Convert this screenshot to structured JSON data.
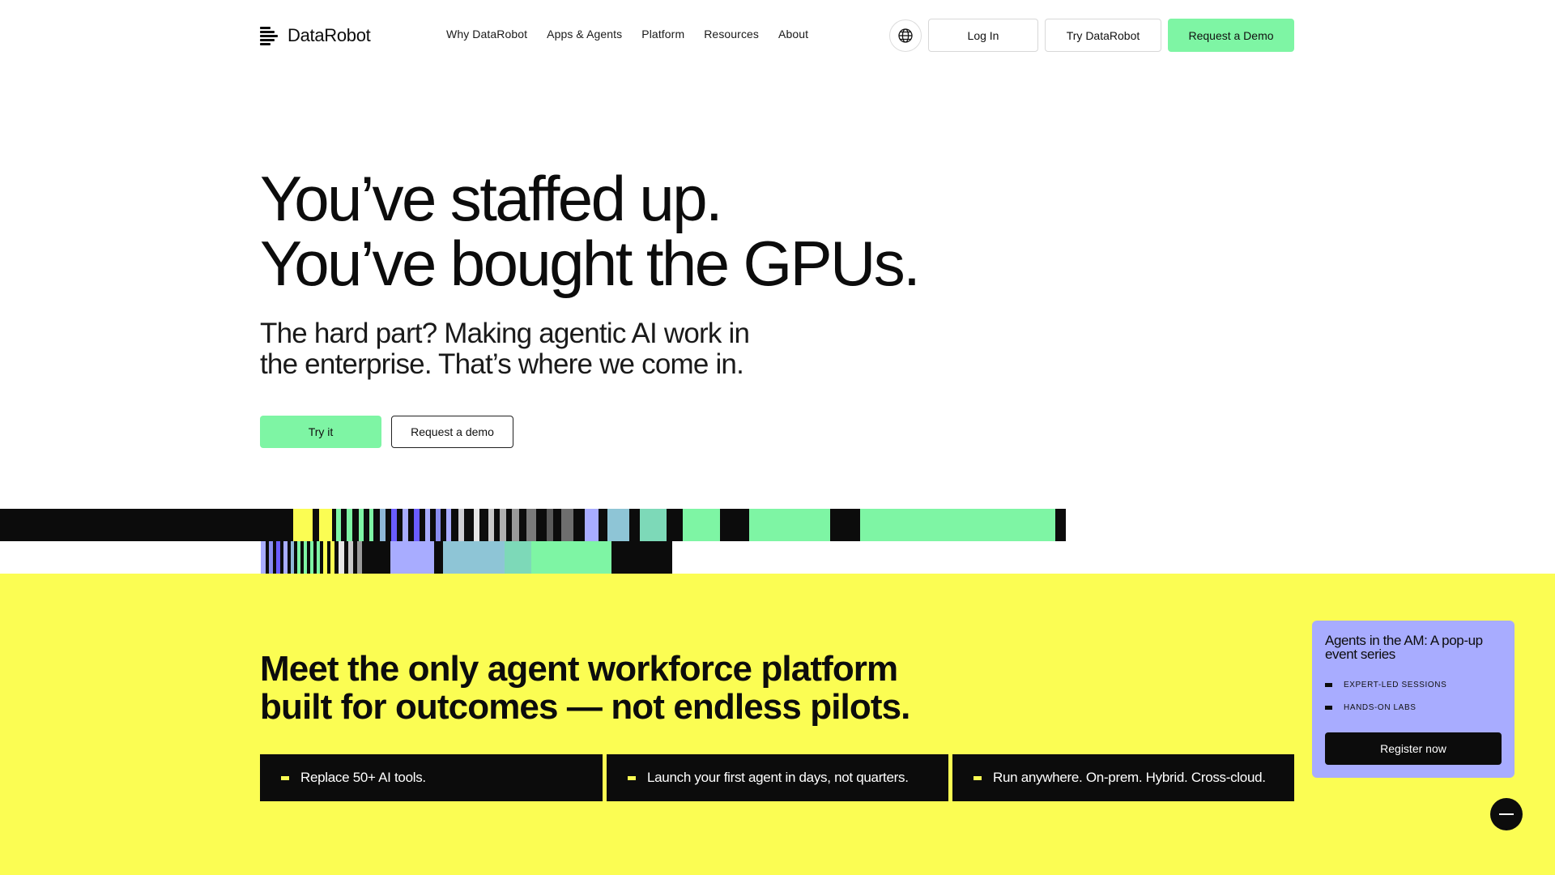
{
  "header": {
    "brand": "DataRobot",
    "nav": [
      {
        "label": "Why DataRobot"
      },
      {
        "label": "Apps & Agents"
      },
      {
        "label": "Platform"
      },
      {
        "label": "Resources"
      },
      {
        "label": "About"
      }
    ],
    "language_icon": "globe-icon",
    "login_label": "Log In",
    "try_label": "Try DataRobot",
    "demo_label": "Request a Demo"
  },
  "hero": {
    "title_line1": "You’ve staffed up.",
    "title_line2": "You’ve bought the GPUs.",
    "subtitle_line1": "The hard part? Making agentic AI work in",
    "subtitle_line2": "the enterprise. That’s where we come in.",
    "try_label": "Try it",
    "demo_label": "Request a demo"
  },
  "colors": {
    "accent_green": "#7ef5a4",
    "accent_yellow": "#fbfd53",
    "accent_lavender": "#a8acff",
    "ink": "#0c0c0c"
  },
  "platform": {
    "headline_line1": "Meet the only agent workforce platform",
    "headline_line2": "built for outcomes — not endless pilots.",
    "features": [
      {
        "label": "Replace 50+ AI tools."
      },
      {
        "label": "Launch your first agent in days, not quarters."
      },
      {
        "label": "Run anywhere. On-prem. Hybrid. Cross-cloud."
      }
    ]
  },
  "promo": {
    "title": "Agents in the AM: A pop-up event series",
    "items": [
      {
        "label": "EXPERT-LED SESSIONS"
      },
      {
        "label": "HANDS-ON LABS"
      }
    ],
    "button_label": "Register now"
  },
  "chat": {
    "icon": "minus-icon"
  }
}
